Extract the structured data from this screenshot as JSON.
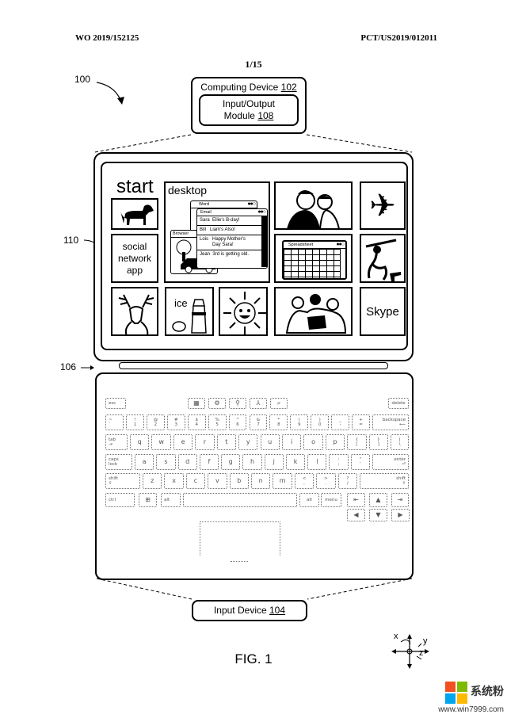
{
  "header": {
    "left": "WO 2019/152125",
    "right": "PCT/US2019/012011",
    "page": "1/15"
  },
  "refs": {
    "system": "100",
    "screen": "110",
    "hinge": "106"
  },
  "computing_device": {
    "label": "Computing Device",
    "ref": "102",
    "module_label_1": "Input/Output",
    "module_label_2": "Module",
    "module_ref": "108"
  },
  "input_device": {
    "label": "Input Device",
    "ref": "104"
  },
  "figure_caption": "FIG. 1",
  "axes": {
    "x": "x",
    "y": "y",
    "z": "z"
  },
  "tiles": {
    "start": "start",
    "desktop": "desktop",
    "social": [
      "social",
      "network",
      "app"
    ],
    "ice": "ice",
    "skype": "Skype",
    "spreadsheet": "Spreadsheet",
    "icons": [
      "dog-image",
      "family-photo-image",
      "airplane-icon",
      "monkey-image",
      "deer-image",
      "cocktail-shaker-image",
      "sun-image",
      "people-group-image"
    ]
  },
  "desktop_windows": {
    "word_title": "Word",
    "email_title": "Email",
    "browser_title": "Browser",
    "emails": [
      {
        "from": "Sara",
        "subject": "Ellie's B-day!"
      },
      {
        "from": "Bill",
        "subject": "Liam's Also!"
      },
      {
        "from": "Lois",
        "subject": "Happy Mother's Day Sara!"
      },
      {
        "from": "Jean",
        "subject": "3rd is getting old."
      }
    ]
  },
  "keyboard": {
    "fn_row": [
      "esc",
      "▦",
      "⚙",
      "⚲",
      "⅄",
      "⌕",
      "delete"
    ],
    "row1": [
      [
        "~",
        "`"
      ],
      [
        "!",
        "1"
      ],
      [
        "@",
        "2"
      ],
      [
        "#",
        "3"
      ],
      [
        "$",
        "4"
      ],
      [
        "%",
        "5"
      ],
      [
        "^",
        "6"
      ],
      [
        "&",
        "7"
      ],
      [
        "*",
        "8"
      ],
      [
        "(",
        "9"
      ],
      [
        ")",
        "0"
      ],
      [
        "_",
        "-"
      ],
      [
        "+",
        "="
      ],
      [
        "backspace",
        "⟵"
      ]
    ],
    "row2": [
      [
        "tab",
        "⇥"
      ],
      [
        "q"
      ],
      [
        "w"
      ],
      [
        "e"
      ],
      [
        "r"
      ],
      [
        "t"
      ],
      [
        "y"
      ],
      [
        "u"
      ],
      [
        "i"
      ],
      [
        "o"
      ],
      [
        "p"
      ],
      [
        "{",
        "["
      ],
      [
        "}",
        "]"
      ],
      [
        "|",
        "\\"
      ]
    ],
    "row3": [
      [
        "caps",
        "lock"
      ],
      [
        "a"
      ],
      [
        "s"
      ],
      [
        "d"
      ],
      [
        "f"
      ],
      [
        "g"
      ],
      [
        "h"
      ],
      [
        "j"
      ],
      [
        "k"
      ],
      [
        "l"
      ],
      [
        ":",
        ";"
      ],
      [
        "\"",
        "'"
      ],
      [
        "enter",
        "⏎"
      ]
    ],
    "row4": [
      [
        "shift",
        "⇧"
      ],
      [
        "z"
      ],
      [
        "x"
      ],
      [
        "c"
      ],
      [
        "v"
      ],
      [
        "b"
      ],
      [
        "n"
      ],
      [
        "m"
      ],
      [
        "<",
        ","
      ],
      [
        ">",
        "."
      ],
      [
        "?",
        "/"
      ],
      [
        "shift",
        "⇧"
      ]
    ],
    "row5": [
      [
        "ctrl"
      ],
      [
        "⊞"
      ],
      [
        "alt"
      ],
      [
        ""
      ],
      [
        "alt"
      ],
      [
        "menu"
      ],
      [
        "⇤"
      ],
      [
        "▲"
      ],
      [
        "⇥"
      ]
    ],
    "arrows": [
      "◀",
      "▼",
      "▶"
    ]
  },
  "watermark": {
    "text": "系统粉",
    "url": "www.win7999.com",
    "colors": [
      "#f25022",
      "#7fba00",
      "#00a4ef",
      "#ffb900"
    ]
  }
}
